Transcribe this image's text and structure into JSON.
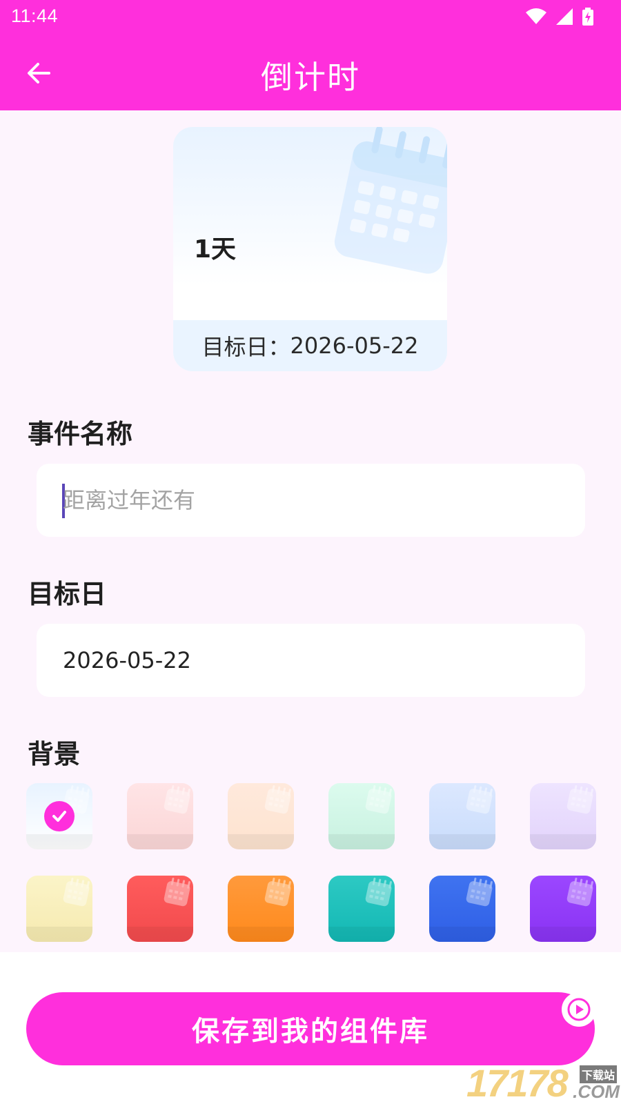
{
  "status_bar": {
    "time": "11:44"
  },
  "header": {
    "title": "倒计时"
  },
  "preview": {
    "days": "1天",
    "target_label": "目标日：",
    "target_date": "2026-05-22"
  },
  "form": {
    "event_name_label": "事件名称",
    "event_name_value": "",
    "event_name_placeholder": "距离过年还有",
    "target_date_label": "目标日",
    "target_date_value": "2026-05-22",
    "background_label": "背景"
  },
  "backgrounds": [
    {
      "id": "light-blue",
      "top": "#e8f3ff",
      "bottom": "#ffffff",
      "selected": true
    },
    {
      "id": "light-pink",
      "top": "#ffe4e6",
      "bottom": "#fbd6d6",
      "selected": false
    },
    {
      "id": "light-peach",
      "top": "#ffe9dc",
      "bottom": "#fde3cf",
      "selected": false
    },
    {
      "id": "light-mint",
      "top": "#dcfbee",
      "bottom": "#c8f1e0",
      "selected": false
    },
    {
      "id": "light-periwinkle",
      "top": "#dce8ff",
      "bottom": "#c9dcfb",
      "selected": false
    },
    {
      "id": "light-lavender",
      "top": "#eee4ff",
      "bottom": "#e2d3fb",
      "selected": false
    },
    {
      "id": "light-yellow",
      "top": "#fbf4c8",
      "bottom": "#f6eab0",
      "selected": false
    },
    {
      "id": "red",
      "top": "#ff5c5c",
      "bottom": "#f24a4d",
      "selected": false
    },
    {
      "id": "orange",
      "top": "#ff9a3c",
      "bottom": "#ff8a1c",
      "selected": false
    },
    {
      "id": "teal",
      "top": "#2dc9c3",
      "bottom": "#13b8b4",
      "selected": false
    },
    {
      "id": "blue",
      "top": "#3f73f0",
      "bottom": "#2f5fe6",
      "selected": false
    },
    {
      "id": "purple",
      "top": "#9b47ff",
      "bottom": "#8a33f3",
      "selected": false
    }
  ],
  "actions": {
    "save_label": "保存到我的组件库"
  },
  "watermark": {
    "number": "17178",
    "site": "下载站",
    "domain": ".COM"
  },
  "colors": {
    "accent": "#ff2fdc",
    "page_bg": "#fdf4fd",
    "field_bg": "#ffffff"
  },
  "icons": {
    "back": "arrow-left-icon",
    "wifi": "wifi-icon",
    "signal": "cell-signal-icon",
    "battery": "battery-charging-icon",
    "calendar": "calendar-icon",
    "check": "check-icon",
    "play": "play-icon"
  }
}
